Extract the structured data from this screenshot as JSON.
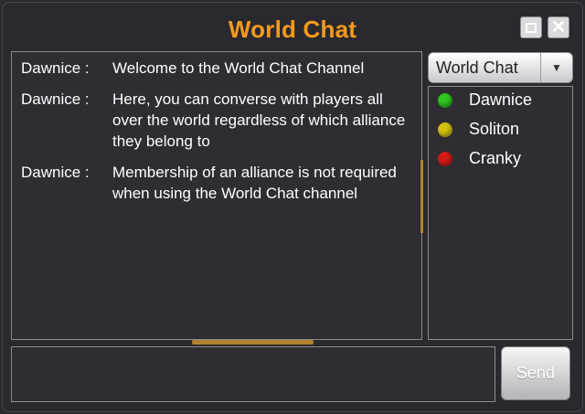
{
  "window": {
    "title": "World Chat"
  },
  "messages": [
    {
      "sender": "Dawnice :",
      "text": "Welcome to the World Chat Channel"
    },
    {
      "sender": "Dawnice :",
      "text": "Here, you can converse with players all over the world regardless of which alliance they belong to"
    },
    {
      "sender": "Dawnice :",
      "text": "Membership of an alliance is not required when using the World Chat channel"
    }
  ],
  "channel_select": {
    "value": "World Chat"
  },
  "users": [
    {
      "name": "Dawnice",
      "status_color": "#2fc81f"
    },
    {
      "name": "Soliton",
      "status_color": "#d4c414"
    },
    {
      "name": "Cranky",
      "status_color": "#d51c16"
    }
  ],
  "composer": {
    "send_label": "Send"
  },
  "colors": {
    "title": "#f59a1e",
    "accent": "#b2802f"
  }
}
